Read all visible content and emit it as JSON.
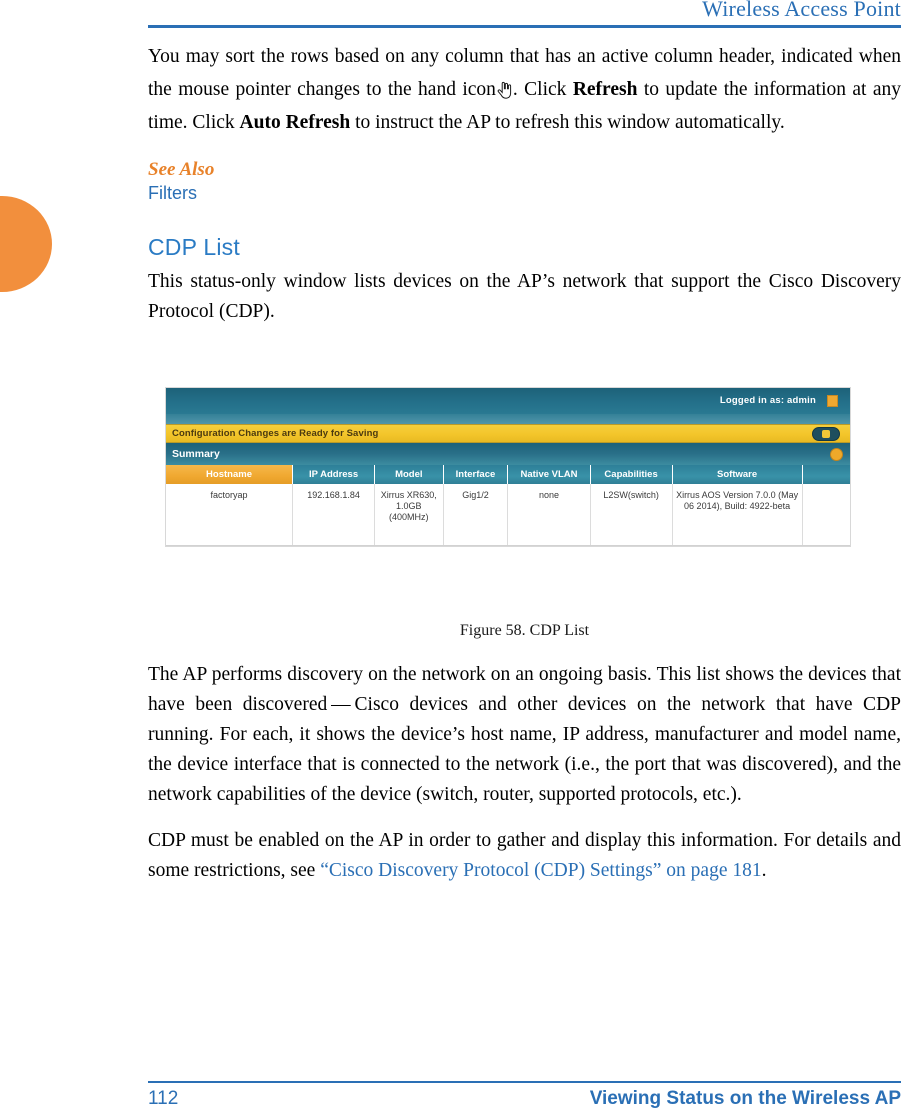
{
  "header": {
    "title": "Wireless Access Point"
  },
  "body": {
    "para1_part1": "You may sort the rows based on any column that has an active column header, indicated when the mouse pointer changes to the hand icon",
    "para1_part2": ". Click ",
    "para1_bold1": "Refresh",
    "para1_part3": " to update the information at any time. Click ",
    "para1_bold2": "Auto Refresh",
    "para1_part4": " to instruct the AP to refresh this window automatically.",
    "see_also_label": "See Also",
    "see_also_link": "Filters",
    "section_heading": "CDP List",
    "para2": "This status-only window lists devices on the AP’s network that support the Cisco Discovery Protocol (CDP).",
    "figure_caption": "Figure 58. CDP List",
    "para3": "The AP performs discovery on the network on an ongoing basis. This list shows the devices that have been discovered — Cisco devices and other devices on the network that have CDP running. For each, it shows the device’s host name, IP address, manufacturer and model name, the device interface that is connected to the network (i.e., the port that was discovered), and the network capabilities of the device (switch, router, supported protocols, etc.).",
    "para4_part1": "CDP must be enabled on the AP in order to gather and display this information. For details and some restrictions, see ",
    "para4_link": "“Cisco Discovery Protocol (CDP) Settings” on page 181",
    "para4_part2": "."
  },
  "screenshot": {
    "topbar": {
      "login_status": "Logged in as: admin",
      "icon": "lock-icon"
    },
    "banner": {
      "text": "Configuration Changes are Ready for Saving",
      "save_button": "save-toggle"
    },
    "section": {
      "title": "Summary",
      "collapse_icon": "collapse-circle-icon"
    },
    "table": {
      "columns": [
        "Hostname",
        "IP Address",
        "Model",
        "Interface",
        "Native VLAN",
        "Capabilities",
        "Software"
      ],
      "active_column": "Hostname",
      "rows": [
        {
          "hostname": "factoryap",
          "ip_address": "192.168.1.84",
          "model": "Xirrus XR630, 1.0GB (400MHz)",
          "interface": "Gig1/2",
          "native_vlan": "none",
          "capabilities": "L2SW(switch)",
          "software": "Xirrus AOS Version 7.0.0 (May 06 2014), Build: 4922-beta"
        }
      ]
    }
  },
  "footer": {
    "page_number": "112",
    "title": "Viewing Status on the Wireless AP"
  },
  "colors": {
    "accent_blue": "#2a6fb5",
    "heading_blue": "#2a7bc4",
    "accent_orange": "#e8822a",
    "tab_orange": "#f28f3d",
    "app_teal": "#2a7089",
    "app_yellow": "#f3c52a"
  }
}
